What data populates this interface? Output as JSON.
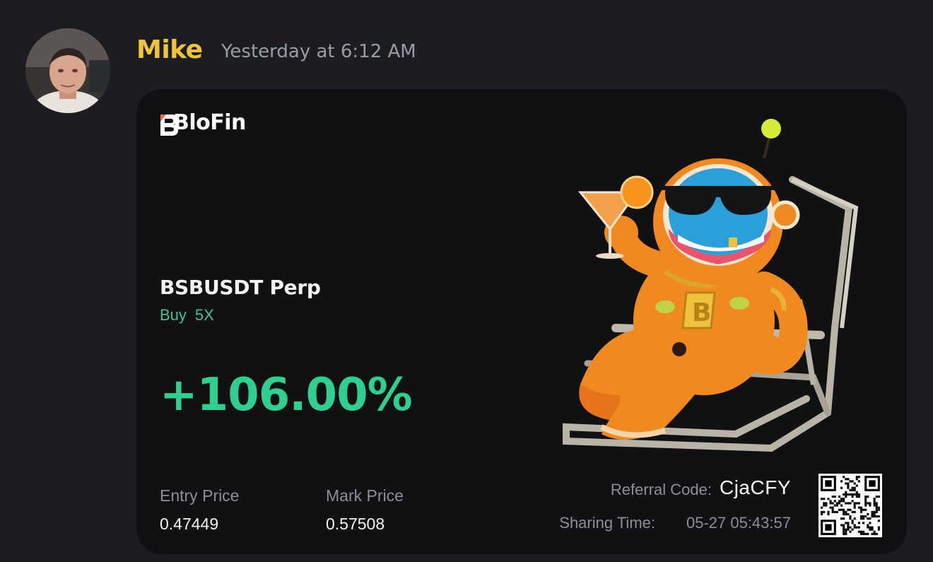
{
  "message": {
    "author": "Mike",
    "timestamp": "Yesterday at 6:12 AM",
    "avatar_icon": "user-photo-avatar"
  },
  "card": {
    "brand": "BloFin",
    "pair": "BSBUSDT Perp",
    "side": "Buy",
    "leverage": "5X",
    "pnl_percent": "+106.00%",
    "entry_price_label": "Entry Price",
    "entry_price": "0.47449",
    "mark_price_label": "Mark Price",
    "mark_price": "0.57508",
    "referral_label": "Referral Code:",
    "referral_code": "CjaCFY",
    "sharing_label": "Sharing Time:",
    "sharing_time": "05-27 05:43:57",
    "illustration_icon": "mascot-lounging-icon",
    "qr_icon": "qr-code-icon",
    "colors": {
      "gain": "#2fd08f",
      "username": "#f0c43a",
      "card_bg": "#111114",
      "page_bg": "#1c1d22"
    }
  }
}
